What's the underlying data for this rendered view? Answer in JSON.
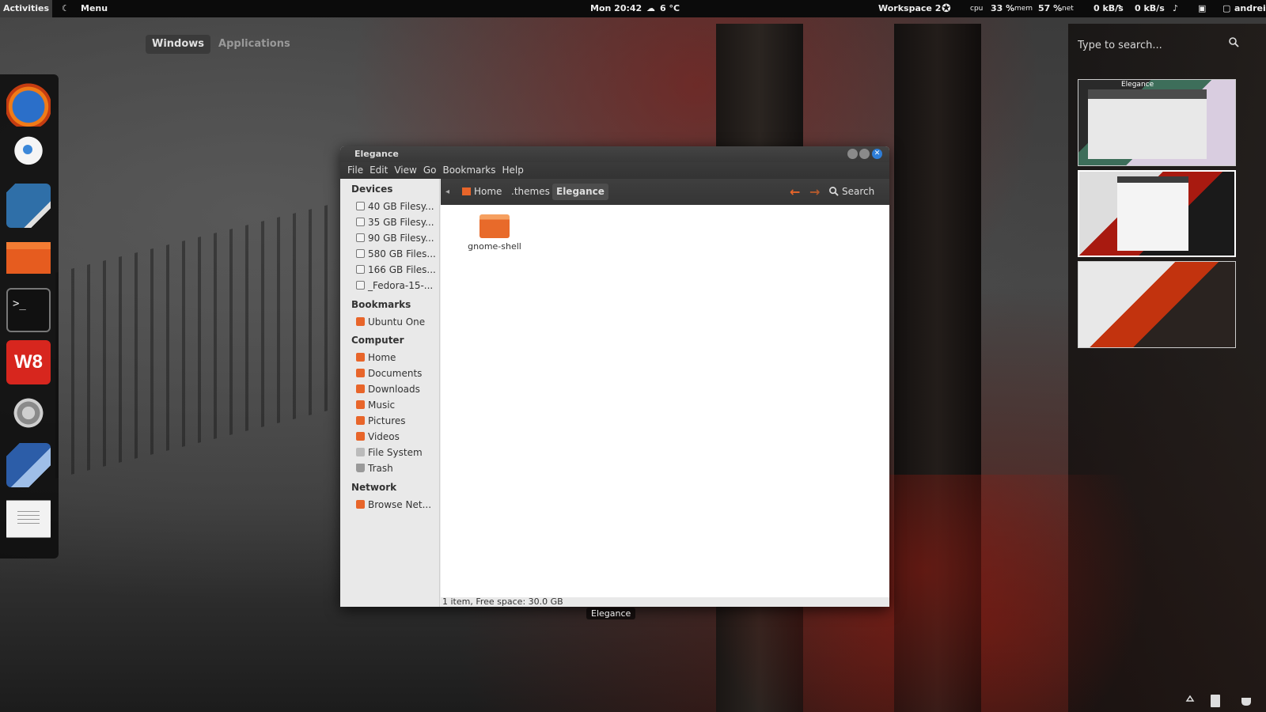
{
  "top_panel": {
    "activities": "Activities",
    "menu": "Menu",
    "clock": "Mon 20:42",
    "weather": "6 °C",
    "workspace": "Workspace 2",
    "cpu_label": "cpu",
    "cpu_value": "33 %",
    "mem_label": "mem",
    "mem_value": "57 %",
    "net_label": "net",
    "net_down": "0 kB/s",
    "net_up": "0 kB/s",
    "user": "andrei"
  },
  "overview": {
    "tabs": [
      {
        "label": "Windows",
        "active": true
      },
      {
        "label": "Applications",
        "active": false
      }
    ],
    "search_placeholder": "Type to search..."
  },
  "dock": {
    "items": [
      {
        "name": "firefox"
      },
      {
        "name": "empathy-chat"
      },
      {
        "name": "image-viewer"
      },
      {
        "name": "home-folder"
      },
      {
        "name": "terminal",
        "glyph": ">_"
      },
      {
        "name": "w8",
        "glyph": "W8"
      },
      {
        "name": "system-settings"
      },
      {
        "name": "virtualbox"
      },
      {
        "name": "text-editor"
      }
    ]
  },
  "workspaces": {
    "thumb1_title": "Elegance",
    "active_index": 1
  },
  "window": {
    "title": "Elegance",
    "menu": [
      "File",
      "Edit",
      "View",
      "Go",
      "Bookmarks",
      "Help"
    ],
    "sidebar": {
      "devices_header": "Devices",
      "devices": [
        "40 GB Filesy...",
        "35 GB Filesy...",
        "90 GB Filesy...",
        "580 GB Files...",
        "166 GB Files...",
        "_Fedora-15-..."
      ],
      "bookmarks_header": "Bookmarks",
      "bookmarks": [
        "Ubuntu One"
      ],
      "computer_header": "Computer",
      "computer": [
        "Home",
        "Documents",
        "Downloads",
        "Music",
        "Pictures",
        "Videos",
        "File System",
        "Trash"
      ],
      "network_header": "Network",
      "network": [
        "Browse Net..."
      ]
    },
    "breadcrumb": [
      "Home",
      ".themes",
      "Elegance"
    ],
    "search_label": "Search",
    "files": [
      {
        "name": "gnome-shell",
        "type": "folder"
      }
    ],
    "status": "1 item, Free space: 30.0 GB",
    "caption": "Elegance"
  }
}
